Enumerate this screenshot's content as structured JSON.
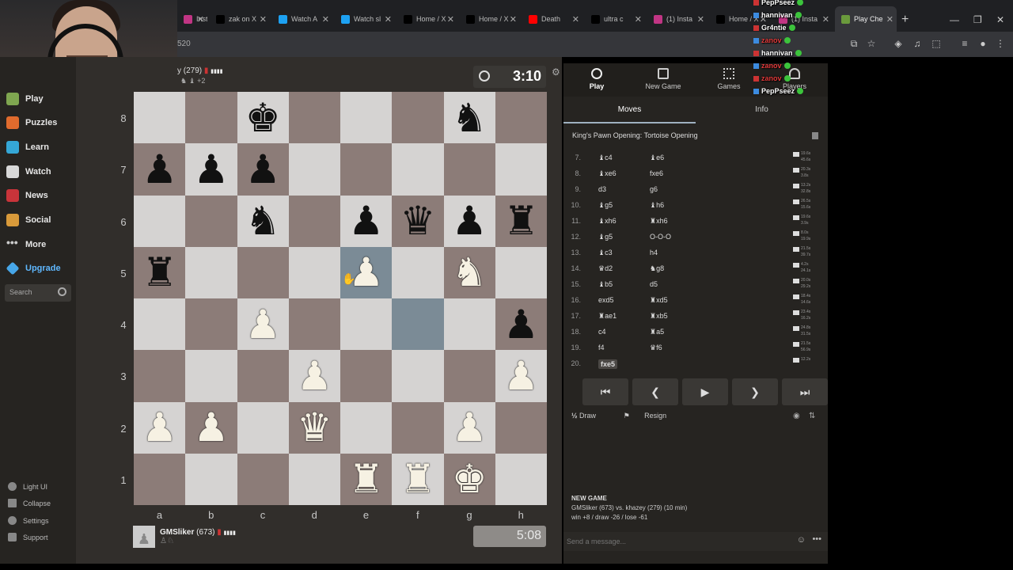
{
  "browser": {
    "tabs": [
      {
        "label": "Instag",
        "fav": "#c13584"
      },
      {
        "label": "zak on X",
        "fav": "#000000"
      },
      {
        "label": "Watch A",
        "fav": "#1da1f2"
      },
      {
        "label": "Watch sl",
        "fav": "#1da1f2"
      },
      {
        "label": "Home / X",
        "fav": "#000000"
      },
      {
        "label": "Home / X",
        "fav": "#000000"
      },
      {
        "label": "Death",
        "fav": "#ff0000"
      },
      {
        "label": "ultra c",
        "fav": "#000000"
      },
      {
        "label": "(1) Insta",
        "fav": "#c13584"
      },
      {
        "label": "Home / X",
        "fav": "#000000"
      },
      {
        "label": "(1) Insta",
        "fav": "#c13584"
      },
      {
        "label": "Play Che",
        "fav": "#6a9a3c"
      }
    ],
    "url": "520"
  },
  "sidebar": {
    "items": [
      "Play",
      "Puzzles",
      "Learn",
      "Watch",
      "News",
      "Social",
      "More"
    ],
    "upgrade": "Upgrade",
    "search_placeholder": "Search",
    "footer": [
      "Light UI",
      "Collapse",
      "Settings",
      "Support"
    ]
  },
  "game": {
    "top_player": {
      "name": "y",
      "rating": "(279)",
      "sub": "+2"
    },
    "top_clock": "3:10",
    "bottom_player": {
      "name": "GMSliker",
      "rating": "(673)"
    },
    "bottom_clock": "5:08",
    "ranks": [
      "8",
      "7",
      "6",
      "5",
      "4",
      "3",
      "2",
      "1"
    ],
    "files": [
      "a",
      "b",
      "c",
      "d",
      "e",
      "f",
      "g",
      "h"
    ],
    "board": [
      [
        "",
        "",
        "bk",
        "",
        "",
        "",
        "bn",
        ""
      ],
      [
        "bp",
        "bp",
        "bp",
        "",
        "",
        "",
        "",
        ""
      ],
      [
        "",
        "",
        "bn",
        "",
        "bp",
        "bq",
        "bp",
        "br"
      ],
      [
        "br",
        "",
        "",
        "",
        "wp",
        "",
        "wn",
        ""
      ],
      [
        "",
        "",
        "wp",
        "",
        "",
        "",
        "",
        "bp"
      ],
      [
        "",
        "",
        "",
        "wp",
        "",
        "",
        "",
        "wp"
      ],
      [
        "wp",
        "wp",
        "",
        "wq",
        "",
        "",
        "wp",
        ""
      ],
      [
        "",
        "",
        "",
        "",
        "wr",
        "wr",
        "wk",
        ""
      ]
    ],
    "highlight": [
      "e5",
      "f4"
    ]
  },
  "panel": {
    "nav": [
      "Play",
      "New Game",
      "Games",
      "Players"
    ],
    "tabs": [
      "Moves",
      "Info"
    ],
    "opening": "King's Pawn Opening: Tortoise Opening",
    "moves": [
      {
        "n": "7.",
        "w": "♝c4",
        "b": "♝e6",
        "t1": "19.6s",
        "t2": "45.6s"
      },
      {
        "n": "8.",
        "w": "♝xe6",
        "b": "fxe6",
        "t1": "20.3s",
        "t2": "3.8s"
      },
      {
        "n": "9.",
        "w": "d3",
        "b": "g6",
        "t1": "13.2s",
        "t2": "32.8s"
      },
      {
        "n": "10.",
        "w": "♝g5",
        "b": "♝h6",
        "t1": "26.5s",
        "t2": "15.6s"
      },
      {
        "n": "11.",
        "w": "♝xh6",
        "b": "♜xh6",
        "t1": "19.6s",
        "t2": "3.9s"
      },
      {
        "n": "12.",
        "w": "♝g5",
        "b": "O-O-O",
        "t1": "8.0s",
        "t2": "19.9s"
      },
      {
        "n": "13.",
        "w": "♝c3",
        "b": "h4",
        "t1": "21.5s",
        "t2": "39.7s"
      },
      {
        "n": "14.",
        "w": "♛d2",
        "b": "♞g8",
        "t1": "4.2s",
        "t2": "24.1s"
      },
      {
        "n": "15.",
        "w": "♝b5",
        "b": "d5",
        "t1": "20.0s",
        "t2": "29.2s"
      },
      {
        "n": "16.",
        "w": "exd5",
        "b": "♜xd5",
        "t1": "18.4s",
        "t2": "14.6s"
      },
      {
        "n": "17.",
        "w": "♜ae1",
        "b": "♜xb5",
        "t1": "23.4s",
        "t2": "16.2s"
      },
      {
        "n": "18.",
        "w": "c4",
        "b": "♜a5",
        "t1": "24.8s",
        "t2": "31.5s"
      },
      {
        "n": "19.",
        "w": "f4",
        "b": "♛f6",
        "t1": "21.5s",
        "t2": "56.9s"
      },
      {
        "n": "20.",
        "w": "fxe5",
        "b": "",
        "t1": "12.2s",
        "t2": ""
      }
    ],
    "actions": {
      "draw": "Draw",
      "resign": "Resign"
    },
    "notice": {
      "title": "NEW GAME",
      "line1": "GMSliker (673) vs. khazey (279) (10 min)",
      "line2": "win +8 / draw -26 / lose -61"
    },
    "chat_placeholder": "Send a message..."
  },
  "overlay_chat": [
    {
      "name": "PepPseez",
      "color": "#ffffff"
    },
    {
      "name": "hannivan",
      "color": "#ffffff"
    },
    {
      "name": "Gr4ntie",
      "color": "#ffffff"
    },
    {
      "name": "zanov",
      "color": "#e03a3a"
    },
    {
      "name": "hannivan",
      "color": "#ffffff"
    },
    {
      "name": "zanov",
      "color": "#e03a3a"
    },
    {
      "name": "zanov",
      "color": "#e03a3a"
    },
    {
      "name": "PepPseez",
      "color": "#ffffff"
    }
  ]
}
